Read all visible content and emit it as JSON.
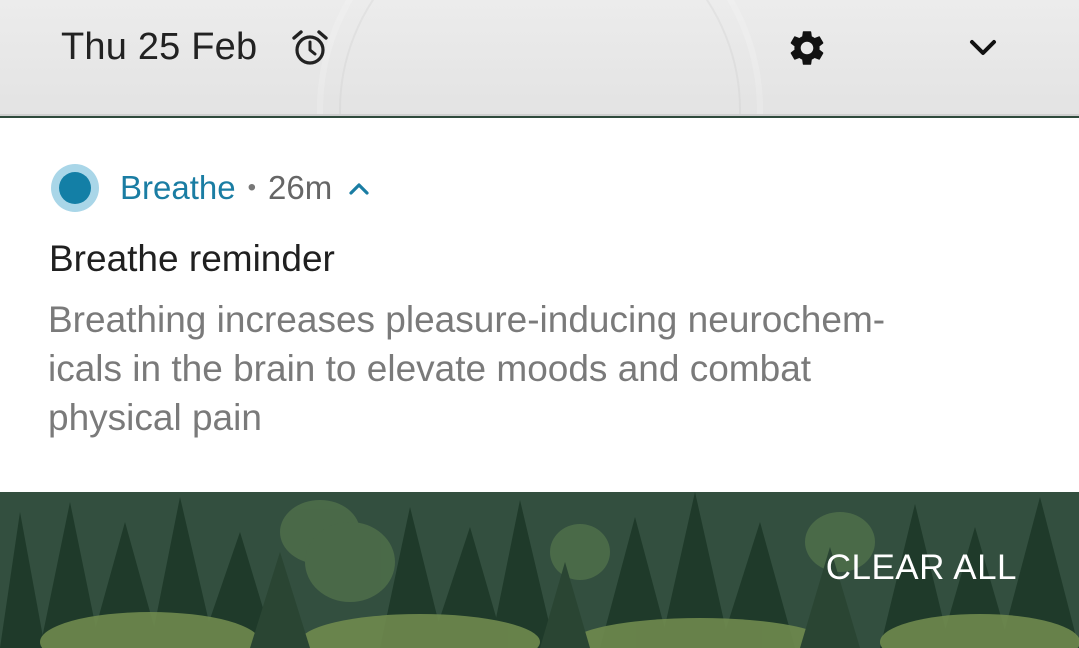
{
  "header": {
    "date": "Thu 25 Feb",
    "icons": {
      "alarm": "alarm-clock-icon",
      "settings": "gear-icon",
      "expand": "chevron-down-icon"
    }
  },
  "notification": {
    "app_name": "Breathe",
    "separator": "•",
    "time_ago": "26m",
    "title": "Breathe reminder",
    "body": "Breathing increases pleasure-inducing neurochem-\nicals in the brain to elevate moods and combat\nphysical pain",
    "accent_color": "#1a7da3",
    "icon": "breathe-app-icon"
  },
  "footer": {
    "clear_all_label": "CLEAR ALL"
  },
  "colors": {
    "header_bg": "#e8e8e8",
    "card_bg": "#ffffff",
    "title_text": "#202020",
    "body_text": "#7a7a7a",
    "wallpaper": "#2f4a3c"
  }
}
